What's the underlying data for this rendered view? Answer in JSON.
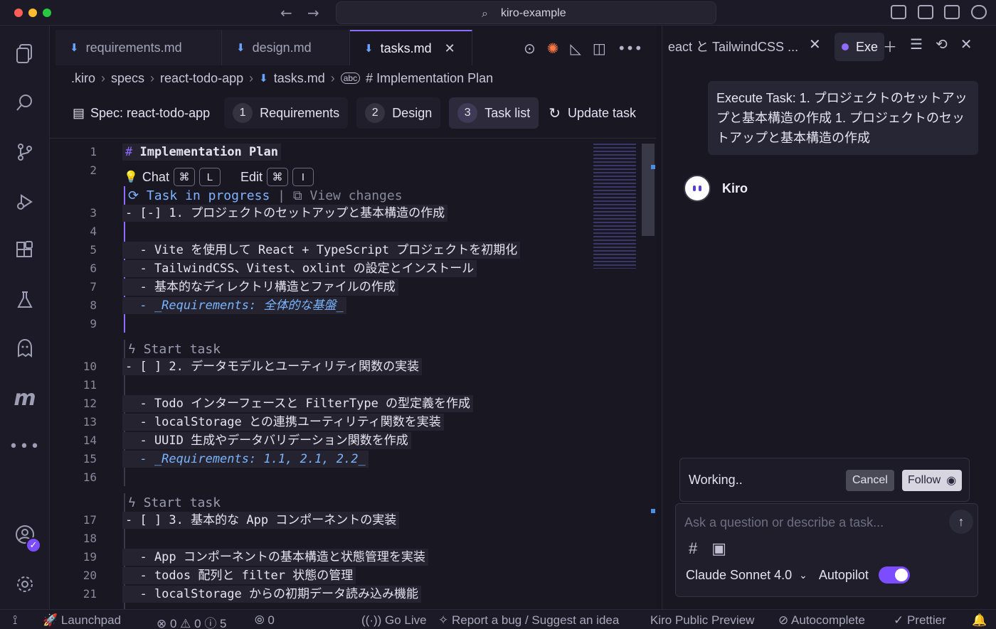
{
  "window": {
    "search_text": "kiro-example"
  },
  "activity_bar": {
    "badge": "✓"
  },
  "editor": {
    "tabs": [
      {
        "label": "requirements.md"
      },
      {
        "label": "design.md"
      },
      {
        "label": "tasks.md"
      }
    ],
    "breadcrumb": [
      ".kiro",
      "specs",
      "react-todo-app",
      "tasks.md",
      "# Implementation Plan"
    ],
    "spec": {
      "label": "Spec: react-todo-app",
      "steps": [
        {
          "num": "1",
          "label": "Requirements"
        },
        {
          "num": "2",
          "label": "Design"
        },
        {
          "num": "3",
          "label": "Task list"
        }
      ],
      "update_label": "Update task"
    },
    "inline_hint": {
      "chat": "Chat",
      "edit": "Edit",
      "key_cmd": "⌘",
      "key_l": "L",
      "key_i": "I"
    },
    "lenses": {
      "in_progress": "Task in progress",
      "view_changes": "View changes",
      "start_task": "Start task"
    },
    "lines": [
      {
        "n": "1",
        "text": "# Implementation Plan"
      },
      {
        "n": "2",
        "text": ""
      },
      {
        "n": "3",
        "text": "- [-] 1. プロジェクトのセットアップと基本構造の作成"
      },
      {
        "n": "4",
        "text": ""
      },
      {
        "n": "5",
        "text": "  - Vite を使用して React + TypeScript プロジェクトを初期化"
      },
      {
        "n": "6",
        "text": "  - TailwindCSS、Vitest、oxlint の設定とインストール"
      },
      {
        "n": "7",
        "text": "  - 基本的なディレクトリ構造とファイルの作成"
      },
      {
        "n": "8",
        "text": "  - _Requirements: 全体的な基盤_"
      },
      {
        "n": "9",
        "text": ""
      },
      {
        "n": "10",
        "text": "- [ ] 2. データモデルとユーティリティ関数の実装"
      },
      {
        "n": "11",
        "text": ""
      },
      {
        "n": "12",
        "text": "  - Todo インターフェースと FilterType の型定義を作成"
      },
      {
        "n": "13",
        "text": "  - localStorage との連携ユーティリティ関数を実装"
      },
      {
        "n": "14",
        "text": "  - UUID 生成やデータバリデーション関数を作成"
      },
      {
        "n": "15",
        "text": "  - _Requirements: 1.1, 2.1, 2.2_"
      },
      {
        "n": "16",
        "text": ""
      },
      {
        "n": "17",
        "text": "- [ ] 3. 基本的な App コンポーネントの実装"
      },
      {
        "n": "18",
        "text": ""
      },
      {
        "n": "19",
        "text": "  - App コンポーネントの基本構造と状態管理を実装"
      },
      {
        "n": "20",
        "text": "  - todos 配列と filter 状態の管理"
      },
      {
        "n": "21",
        "text": "  - localStorage からの初期データ読み込み機能"
      }
    ]
  },
  "chat": {
    "tab1_label": "eact と TailwindCSS ...",
    "tab2_label": "Exe",
    "user_message": "Execute Task: 1. プロジェクトのセットアップと基本構造の作成 1. プロジェクトのセットアップと基本構造の作成",
    "agent_name": "Kiro",
    "working_text": "Working..",
    "cancel_label": "Cancel",
    "follow_label": "Follow",
    "input_placeholder": "Ask a question or describe a task...",
    "model": "Claude Sonnet 4.0",
    "mode": "Autopilot"
  },
  "status_bar": {
    "launchpad": "Launchpad",
    "errors": "0",
    "warnings": "0",
    "infos": "5",
    "ports": "0",
    "go_live": "Go Live",
    "report": "Report a bug / Suggest an idea",
    "preview": "Kiro Public Preview",
    "autocomplete": "Autocomplete",
    "prettier": "Prettier"
  },
  "colors": {
    "accent": "#8f6bff",
    "link": "#79b4ff",
    "background": "#181722"
  }
}
